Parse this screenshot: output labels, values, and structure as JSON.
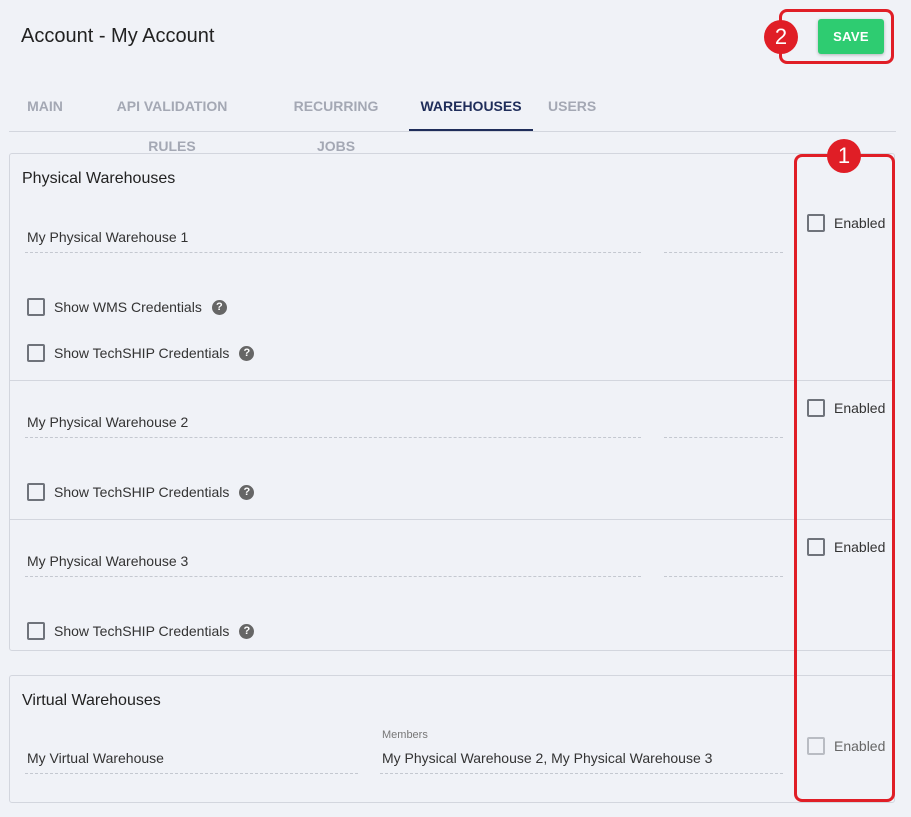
{
  "header": {
    "title": "Account - My Account",
    "save_label": "SAVE"
  },
  "tabs": [
    {
      "label": "MAIN",
      "active": false
    },
    {
      "label": "API VALIDATION RULES",
      "active": false
    },
    {
      "label": "RECURRING JOBS",
      "active": false
    },
    {
      "label": "WAREHOUSES",
      "active": true
    },
    {
      "label": "USERS",
      "active": false
    }
  ],
  "physical": {
    "title": "Physical Warehouses",
    "warehouses": [
      {
        "name": "My Physical Warehouse 1",
        "enabled_label": "Enabled",
        "wms_label": "Show WMS Credentials",
        "techship_label": "Show TechSHIP Credentials"
      },
      {
        "name": "My Physical Warehouse 2",
        "enabled_label": "Enabled",
        "techship_label": "Show TechSHIP Credentials"
      },
      {
        "name": "My Physical Warehouse 3",
        "enabled_label": "Enabled",
        "techship_label": "Show TechSHIP Credentials"
      }
    ]
  },
  "virtual": {
    "title": "Virtual Warehouses",
    "name": "My Virtual Warehouse",
    "members_label": "Members",
    "members_value": "My Physical Warehouse 2, My Physical Warehouse 3",
    "enabled_label": "Enabled"
  },
  "annotations": {
    "badge_1": "1",
    "badge_2": "2"
  },
  "icons": {
    "help": "question-circle-icon",
    "checkbox": "checkbox-icon"
  },
  "colors": {
    "save": "#2ecc71",
    "active_tab": "#1f2d5a",
    "annotation": "#e01e26"
  }
}
